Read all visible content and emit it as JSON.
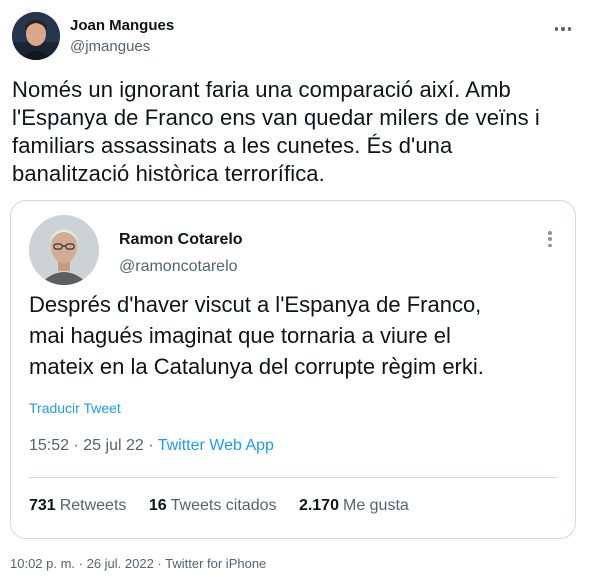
{
  "author": {
    "display_name": "Joan Mangues",
    "handle": "@jmangues"
  },
  "tweet": {
    "text_lines": [
      "Només un ignorant faria una comparació així. Amb",
      "l'Espanya de Franco ens van quedar milers de veïns i",
      "familiars assassinats a les cunetes. És d'una",
      "banalització històrica terrorífica."
    ]
  },
  "quoted": {
    "display_name": "Ramon Cotarelo",
    "handle": "@ramoncotarelo",
    "text_lines": [
      "Després d'haver viscut a l'Espanya de Franco,",
      "mai hagués imaginat que tornaria a viure el",
      "mateix en la Catalunya del corrupte règim erki."
    ],
    "translate_label": "Traducir Tweet",
    "time": "15:52",
    "date": "25 jul 22",
    "separator": "·",
    "app": "Twitter Web App",
    "stats": {
      "retweets_count": "731",
      "retweets_label": "Retweets",
      "quotes_count": "16",
      "quotes_label": "Tweets citados",
      "likes_count": "2.170",
      "likes_label": "Me gusta"
    }
  },
  "footer": {
    "meta": "10:02 p. m. · 26 jul. 2022 · Twitter for iPhone"
  },
  "icons": {
    "more": "more-horizontal-icon",
    "quoted_more": "more-vertical-icon"
  },
  "colors": {
    "link": "#1d9bf0",
    "secondary_text": "#536471",
    "border": "#cfd9de"
  }
}
